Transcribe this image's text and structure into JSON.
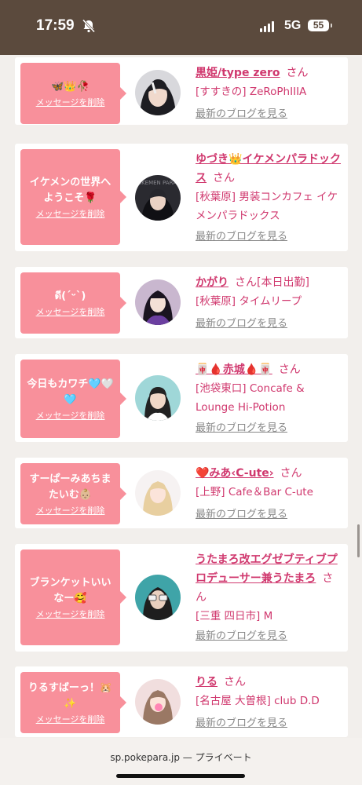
{
  "status_bar": {
    "time": "17:59",
    "network": "5G",
    "battery": "55"
  },
  "delete_label": "メッセージを削除",
  "blog_label": "最新のブログを見る",
  "san_label": "さん",
  "cards": [
    {
      "message": "🦋👑🥀",
      "name": "黒姫/type zero",
      "status": "",
      "shop": "[すすきの] ZeRoPhIIIA"
    },
    {
      "message": "イケメンの世界へようこそ🌹",
      "name": "ゆづき👑イケメンパラドックス",
      "status": "",
      "shop": "[秋葉原] 男装コンカフェ イケメンパラドックス"
    },
    {
      "message": "ดี(ˊᵕˋ)",
      "name": "かがり",
      "status": "[本日出勤]",
      "shop": "[秋葉原] タイムリープ"
    },
    {
      "message": "今日もカワチ🩵🤍🩵",
      "name": "🀄🩸赤城🩸🀄",
      "status": "",
      "shop": "[池袋東口] Concafe & Lounge Hi-Potion"
    },
    {
      "message": "すーぱーみあちまたいむ👶🏼",
      "name": "❤️みあ‹C-ute›",
      "status": "",
      "shop": "[上野] Cafe＆Bar C-ute"
    },
    {
      "message": "ブランケットいいなー🥰",
      "name": "うたまろ改エグゼブティブプロデューサー兼うたまろ",
      "status": "",
      "shop": "[三重 四日市] M"
    },
    {
      "message": "りるすばーっ！🐹✨",
      "name": "りる",
      "status": "",
      "shop": "[名古屋 大曽根] club D.D"
    }
  ],
  "footer": {
    "site": "sp.pokepara.jp",
    "mode": "— プライベート"
  }
}
